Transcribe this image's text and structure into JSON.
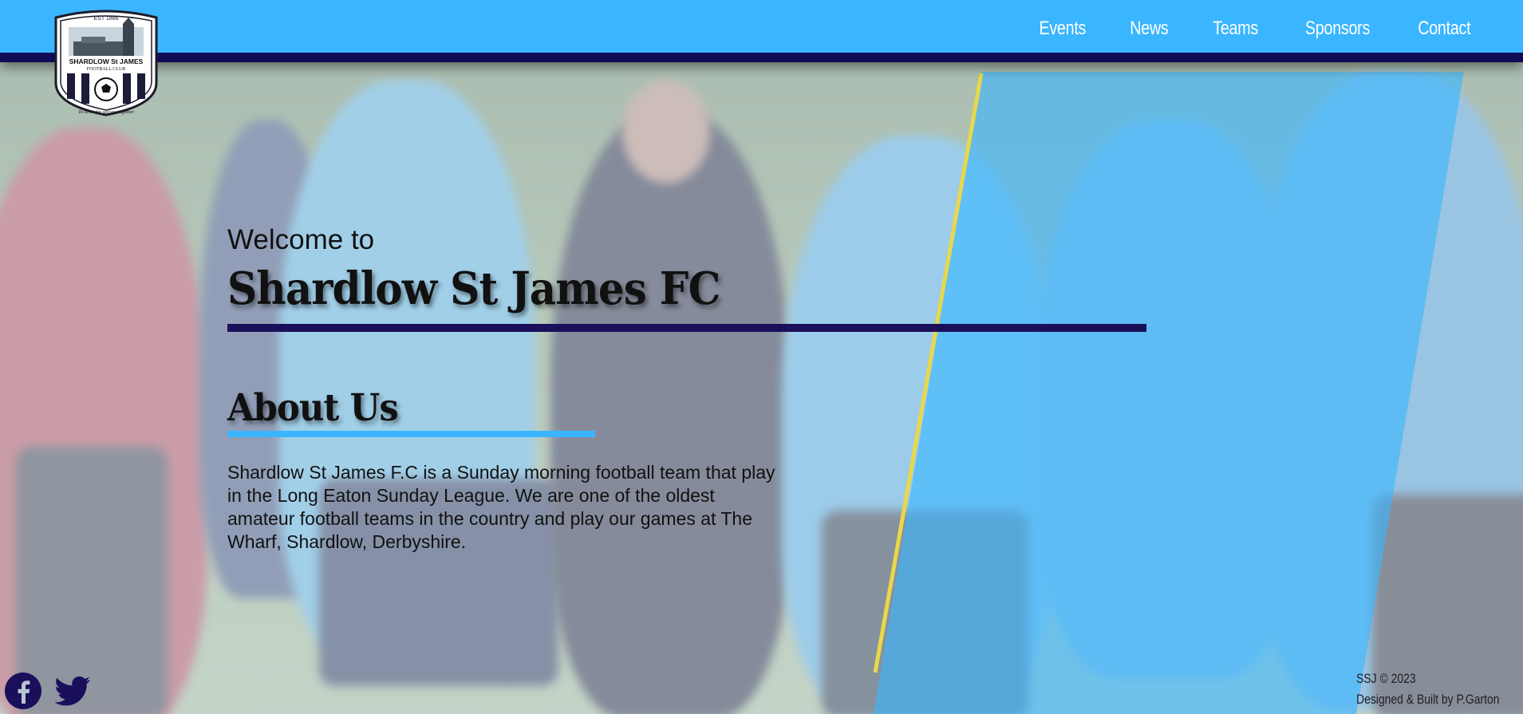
{
  "nav": {
    "items": [
      {
        "label": "Events"
      },
      {
        "label": "News"
      },
      {
        "label": "Teams"
      },
      {
        "label": "Sponsors"
      },
      {
        "label": "Contact"
      }
    ]
  },
  "logo": {
    "est_text": "EST 1886",
    "name_text": "SHARDLOW St JAMES",
    "club_text": "FOOTBALL CLUB",
    "motto": "To strive for success together"
  },
  "hero": {
    "welcome": "Welcome to",
    "title": "Shardlow St James FC"
  },
  "about": {
    "title": "About Us",
    "text": "Shardlow St James F.C is a Sunday morning football team that play in the Long Eaton Sunday League. We are one of the oldest amateur football teams in the country and play our games at The Wharf, Shardlow, Derbyshire."
  },
  "social": {
    "icons": [
      "facebook-icon",
      "twitter-icon"
    ]
  },
  "footer": {
    "copyright": "SSJ © 2023",
    "credit": "Designed & Built by P.Garton"
  },
  "colors": {
    "header_blue": "#3ab5ff",
    "navy": "#0f0b55",
    "accent_yellow": "#e8d84a",
    "panel_blue": "#3ab5ff"
  }
}
